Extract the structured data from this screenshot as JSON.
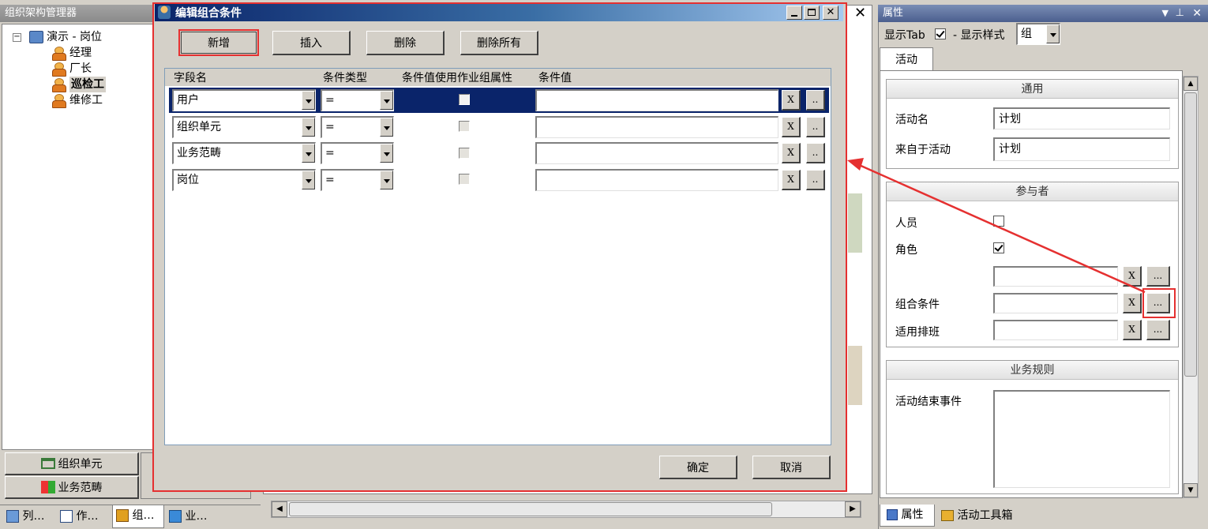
{
  "left_panel": {
    "title": "组织架构管理器",
    "tree_root": "演示 - 岗位",
    "tree_items": [
      "经理",
      "厂长",
      "巡检工",
      "维修工"
    ],
    "bottom_buttons": [
      "组织单元",
      "业务范畴"
    ],
    "tabs": [
      "列…",
      "作…",
      "组…",
      "业…"
    ]
  },
  "dialog": {
    "title": "编辑组合条件",
    "toolbar": {
      "add": "新增",
      "insert": "插入",
      "delete": "删除",
      "delete_all": "删除所有"
    },
    "columns": [
      "字段名",
      "条件类型",
      "条件值使用作业组属性",
      "条件值"
    ],
    "rows": [
      {
        "field": "用户",
        "op": "="
      },
      {
        "field": "组织单元",
        "op": "="
      },
      {
        "field": "业务范畴",
        "op": "="
      },
      {
        "field": "岗位",
        "op": "="
      }
    ],
    "btn_x": "X",
    "btn_more": "..",
    "ok": "确定",
    "cancel": "取消"
  },
  "properties": {
    "title": "属性",
    "show_tab_label": "显示Tab",
    "show_style_label": "- 显示样式",
    "style_value": "组",
    "tab": "活动",
    "sections": {
      "general": "通用",
      "participants": "参与者",
      "rules": "业务规则"
    },
    "activity_name_label": "活动名",
    "activity_name_value": "计划",
    "from_activity_label": "来自于活动",
    "from_activity_value": "计划",
    "person_label": "人员",
    "role_label": "角色",
    "combo_label": "组合条件",
    "shift_label": "适用排班",
    "end_event_label": "活动结束事件",
    "btn_x": "X",
    "btn_more": "...",
    "bottom_tabs": [
      "属性",
      "活动工具箱"
    ]
  },
  "colors": {
    "highlight_red": "#e53030",
    "selected_row": "#0a246a",
    "title_blue": "#0a246a"
  }
}
